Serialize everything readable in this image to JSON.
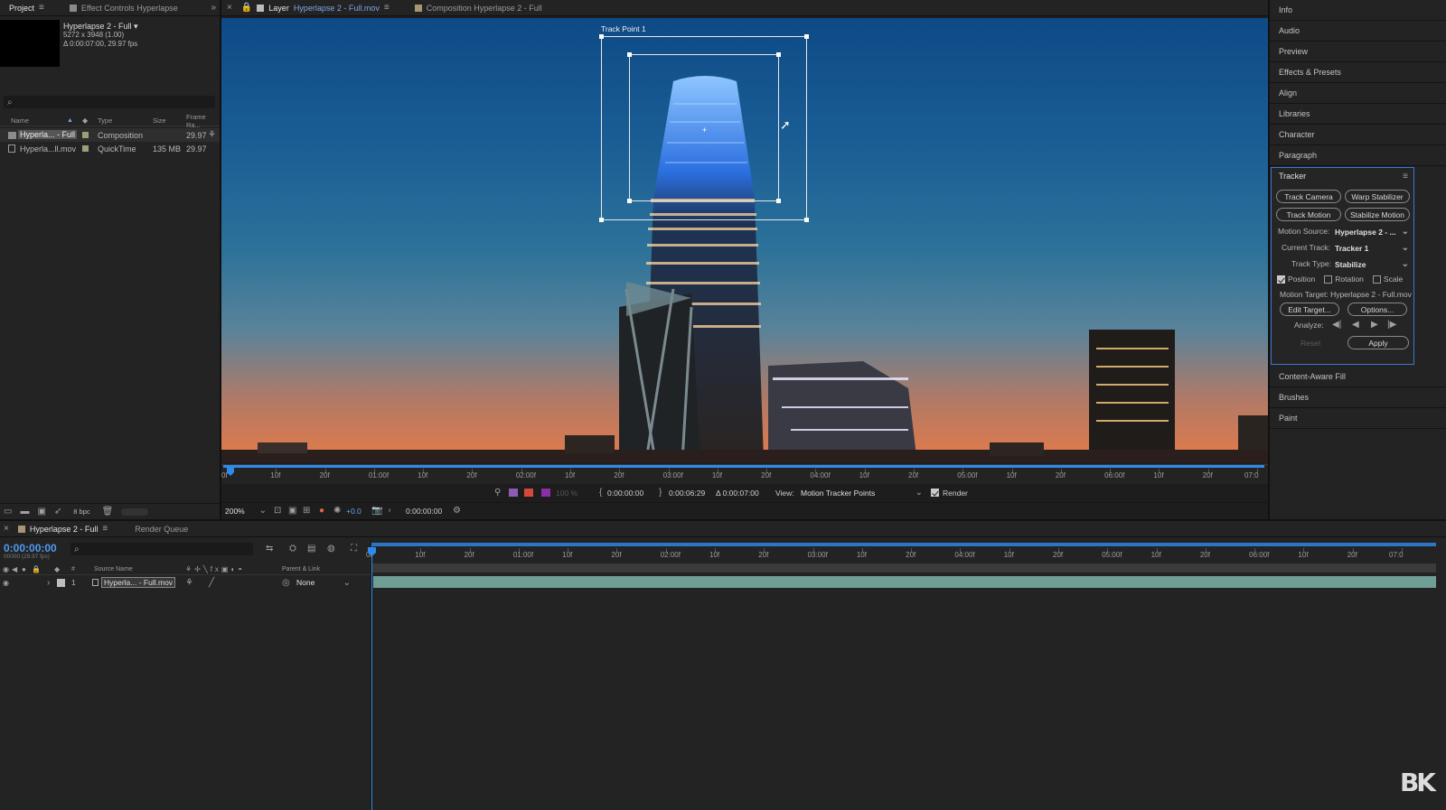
{
  "project": {
    "tabs": {
      "project": "Project",
      "effect_controls": "Effect Controls Hyperlapse"
    },
    "comp": {
      "name": "Hyperlapse 2 - Full ▾",
      "dims": "5272 x 3948 (1.00)",
      "duration": "Δ 0:00:07:00, 29.97 fps"
    },
    "columns": {
      "name": "Name",
      "type": "Type",
      "size": "Size",
      "frame_rate": "Frame Ra..."
    },
    "items": [
      {
        "name": "Hyperla... - Full",
        "type": "Composition",
        "size": "",
        "fps": "29.97"
      },
      {
        "name": "Hyperla...ll.mov",
        "type": "QuickTime",
        "size": "135 MB",
        "fps": "29.97"
      }
    ],
    "bpc": "8 bpc"
  },
  "viewer": {
    "tabs": {
      "layer_prefix": "Layer",
      "layer_name": "Hyperlapse 2 - Full.mov",
      "composition": "Composition Hyperlapse 2 - Full"
    },
    "track_point_label": "Track Point 1",
    "ruler": [
      "0f",
      "10f",
      "20f",
      "01:00f",
      "10f",
      "20f",
      "02:00f",
      "10f",
      "20f",
      "03:00f",
      "10f",
      "20f",
      "04:00f",
      "10f",
      "20f",
      "05:00f",
      "10f",
      "20f",
      "06:00f",
      "10f",
      "20f",
      "07:0"
    ],
    "controls": {
      "in_time": "0:00:00:00",
      "out_time": "0:00:06:29",
      "duration": "Δ 0:00:07:00",
      "view_label": "View:",
      "view_value": "Motion Tracker Points",
      "render_label": "Render",
      "zoom": "200%",
      "exposure": "+0.0",
      "current_time": "0:00:00:00",
      "percent": "100 %"
    }
  },
  "right_panel": {
    "items_top": [
      "Info",
      "Audio",
      "Preview",
      "Effects & Presets",
      "Align",
      "Libraries",
      "Character",
      "Paragraph"
    ],
    "tracker": {
      "title": "Tracker",
      "track_camera": "Track Camera",
      "warp_stabilizer": "Warp Stabilizer",
      "track_motion": "Track Motion",
      "stabilize_motion": "Stabilize Motion",
      "motion_source_label": "Motion Source:",
      "motion_source_value": "Hyperlapse 2 - ...",
      "current_track_label": "Current Track:",
      "current_track_value": "Tracker 1",
      "track_type_label": "Track Type:",
      "track_type_value": "Stabilize",
      "position": "Position",
      "rotation": "Rotation",
      "scale": "Scale",
      "motion_target": "Motion Target: Hyperlapse 2 - Full.mov",
      "edit_target": "Edit Target...",
      "options": "Options...",
      "analyze_label": "Analyze:",
      "reset": "Reset",
      "apply": "Apply"
    },
    "items_bottom": [
      "Content-Aware Fill",
      "Brushes",
      "Paint"
    ]
  },
  "timeline": {
    "tabs": {
      "comp": "Hyperlapse 2 - Full",
      "render_queue": "Render Queue"
    },
    "time": "0:00:00:00",
    "frames": "00000 (29.97 fps)",
    "columns": {
      "source_name": "Source Name",
      "parent_link": "Parent & Link",
      "num": "#"
    },
    "layer": {
      "index": "1",
      "name": "Hyperla... - Full.mov",
      "parent": "None"
    },
    "ruler": [
      "0f",
      "10f",
      "20f",
      "01:00f",
      "10f",
      "20f",
      "02:00f",
      "10f",
      "20f",
      "03:00f",
      "10f",
      "20f",
      "04:00f",
      "10f",
      "20f",
      "05:00f",
      "10f",
      "20f",
      "06:00f",
      "10f",
      "20f",
      "07:0"
    ]
  },
  "watermark": "BK",
  "colors": {
    "accent": "#2d8ceb",
    "bg": "#1d1d1d",
    "panel": "#232323",
    "layer_bar": "#6f9e95"
  }
}
